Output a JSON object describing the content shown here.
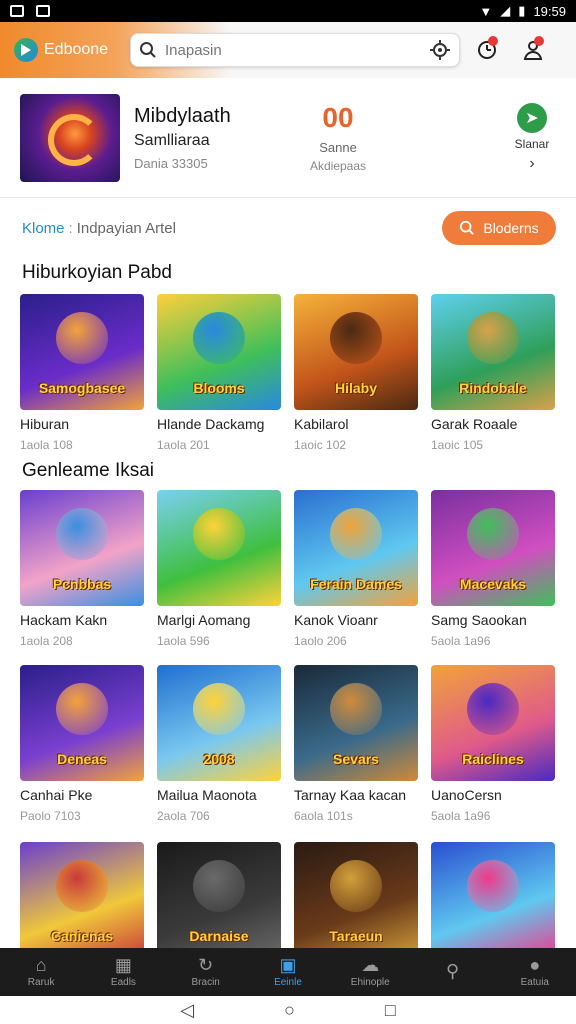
{
  "status": {
    "time": "19:59"
  },
  "header": {
    "logo_text": "Edboone",
    "search_placeholder": "Inapasin"
  },
  "featured": {
    "title": "Mibdylaath",
    "subtitle": "Samlliaraa",
    "meta": "Dania 33305",
    "score": "00",
    "score_label": "Sanne",
    "score_sub": "Akdiepaas",
    "share_label": "Slanar"
  },
  "breadcrumb": {
    "home": "Klome",
    "separator": ":",
    "path": "Indpayian Artel"
  },
  "action_button": {
    "label": "Bloderns"
  },
  "sections": [
    {
      "title": "Hiburkoyian Pabd",
      "items": [
        {
          "title": "Hiburan",
          "meta": "1aola 108",
          "label": "Samogbasee",
          "colors": [
            "#2a1f8a",
            "#6a2cc9",
            "#f2a33a"
          ]
        },
        {
          "title": "Hlande Dackamg",
          "meta": "1aola 201",
          "label": "Blooms",
          "colors": [
            "#ffcf3a",
            "#3fbf5a",
            "#2a88e0"
          ]
        },
        {
          "title": "Kabilarol",
          "meta": "1aoic 102",
          "label": "Hilaby",
          "colors": [
            "#f6b23a",
            "#c2541a",
            "#4a2a12"
          ]
        },
        {
          "title": "Garak Roaale",
          "meta": "1aoic 105",
          "label": "Rindobale",
          "colors": [
            "#5fd0ef",
            "#2f9f5a",
            "#d9a14a"
          ]
        }
      ]
    },
    {
      "title": "Genleame Iksai",
      "items": [
        {
          "title": "Hackam Kakn",
          "meta": "1aola 208",
          "label": "Pcnbbas",
          "colors": [
            "#6a3fd0",
            "#f2a3c8",
            "#3a8fe0"
          ]
        },
        {
          "title": "Marlgi Aomang",
          "meta": "1aola 596",
          "label": "",
          "colors": [
            "#7ad0f2",
            "#3fbf3f",
            "#ffd23a"
          ]
        },
        {
          "title": "Kanok Vioanr",
          "meta": "1aolo 206",
          "label": "Ferain Dames",
          "colors": [
            "#2a6fd0",
            "#5fc8f0",
            "#f2a33a"
          ]
        },
        {
          "title": "Samg Saookan",
          "meta": "5aola 1a96",
          "label": "Macevaks",
          "colors": [
            "#7a2fa0",
            "#d04fc0",
            "#3fbf5a"
          ]
        }
      ]
    },
    {
      "title": "",
      "items": [
        {
          "title": "Canhai Pke",
          "meta": "Paolo 7103",
          "label": "Deneas",
          "colors": [
            "#2a1f8a",
            "#7a3fd0",
            "#f2a33a"
          ]
        },
        {
          "title": "Mailua Maonota",
          "meta": "2aola 706",
          "label": "2008",
          "colors": [
            "#1f6fd0",
            "#7ac8f0",
            "#ffd23a"
          ]
        },
        {
          "title": "Tarnay Kaa kacan",
          "meta": "6aola 101s",
          "label": "Sevars",
          "colors": [
            "#1a2a3a",
            "#3a6a8a",
            "#d08a3a"
          ]
        },
        {
          "title": "UanoCersn",
          "meta": "5aola 1a96",
          "label": "Raiclines",
          "colors": [
            "#f0a33a",
            "#e05a8a",
            "#4a2ac0"
          ]
        }
      ]
    },
    {
      "title": "",
      "items": [
        {
          "title": "",
          "meta": "",
          "label": "Canienas",
          "colors": [
            "#6a3fd0",
            "#f0c83a",
            "#c83a3a"
          ]
        },
        {
          "title": "",
          "meta": "",
          "label": "Darnaise",
          "colors": [
            "#1a1a1a",
            "#3a3a3a",
            "#6a6a6a"
          ]
        },
        {
          "title": "",
          "meta": "",
          "label": "Taraeun",
          "colors": [
            "#2a1a12",
            "#6a3a1a",
            "#d0a03a"
          ]
        },
        {
          "title": "",
          "meta": "",
          "label": "",
          "colors": [
            "#2a4fd0",
            "#5fc8f0",
            "#f03a8a"
          ]
        }
      ]
    }
  ],
  "bottom_nav": [
    {
      "label": "Raruk",
      "icon": "home-icon"
    },
    {
      "label": "Eadls",
      "icon": "grid-icon"
    },
    {
      "label": "Bracin",
      "icon": "refresh-icon"
    },
    {
      "label": "Eeinle",
      "icon": "game-icon",
      "active": true
    },
    {
      "label": "Ehinople",
      "icon": "cloud-icon"
    },
    {
      "label": "",
      "icon": "search-icon"
    },
    {
      "label": "Eatuia",
      "icon": "profile-icon"
    }
  ]
}
